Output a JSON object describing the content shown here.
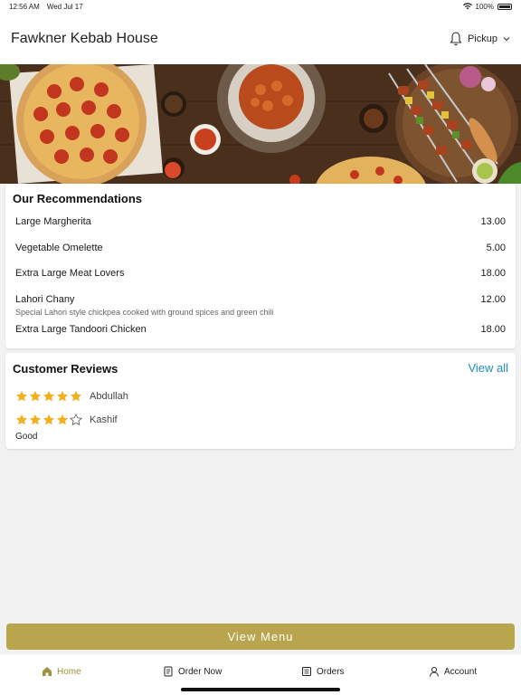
{
  "status_bar": {
    "time": "12:56 AM",
    "date": "Wed Jul 17",
    "battery": "100%"
  },
  "header": {
    "title": "Fawkner Kebab House",
    "mode": "Pickup",
    "bell_icon": "bell-icon",
    "chevron_icon": "chevron-down-icon"
  },
  "recommendations": {
    "title": "Our Recommendations",
    "items": [
      {
        "name": "Large Margherita",
        "price": "13.00",
        "desc": ""
      },
      {
        "name": "Vegetable Omelette",
        "price": "5.00",
        "desc": ""
      },
      {
        "name": "Extra Large Meat Lovers",
        "price": "18.00",
        "desc": ""
      },
      {
        "name": "Lahori Chany",
        "price": "12.00",
        "desc": "Special Lahori style chickpea cooked with ground spices and green chili"
      },
      {
        "name": "Extra Large Tandoori Chicken",
        "price": "18.00",
        "desc": ""
      }
    ]
  },
  "reviews": {
    "title": "Customer Reviews",
    "view_all": "View all",
    "items": [
      {
        "name": "Abdullah",
        "rating": 5,
        "text": ""
      },
      {
        "name": "Kashif",
        "rating": 4,
        "text": "Good"
      }
    ]
  },
  "view_menu_label": "View Menu",
  "tabs": [
    {
      "label": "Home",
      "icon": "home-icon",
      "active": true
    },
    {
      "label": "Order Now",
      "icon": "order-icon",
      "active": false
    },
    {
      "label": "Orders",
      "icon": "orders-list-icon",
      "active": false
    },
    {
      "label": "Account",
      "icon": "account-icon",
      "active": false
    }
  ],
  "colors": {
    "accent": "#b8a54d",
    "active_tab": "#a08f3c",
    "link": "#1b8ec0",
    "star": "#f2b01e"
  }
}
